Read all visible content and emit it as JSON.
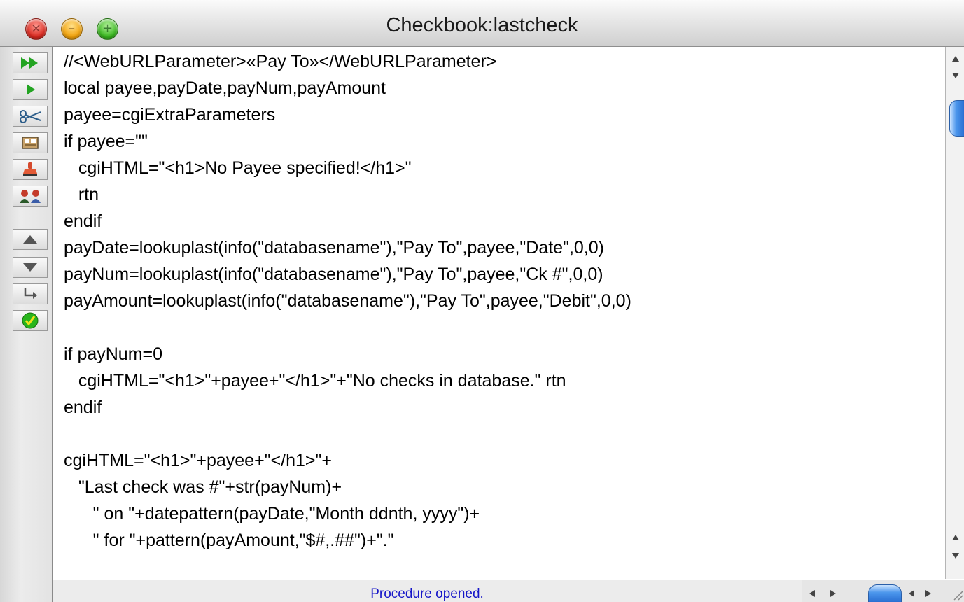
{
  "window": {
    "title": "Checkbook:lastcheck"
  },
  "traffic_lights": {
    "close_glyph": "×",
    "minimize_glyph": "–",
    "zoom_glyph": "+"
  },
  "toolbar": {
    "buttons": [
      {
        "name": "run-all",
        "icon": "double-play-icon"
      },
      {
        "name": "run-step",
        "icon": "play-icon"
      },
      {
        "name": "cut",
        "icon": "scissors-icon"
      },
      {
        "name": "dialog",
        "icon": "dialog-icon"
      },
      {
        "name": "stamp",
        "icon": "stamp-icon"
      },
      {
        "name": "people",
        "icon": "people-icon"
      },
      {
        "name": "up",
        "icon": "triangle-up-icon"
      },
      {
        "name": "down",
        "icon": "triangle-down-icon"
      },
      {
        "name": "indent",
        "icon": "return-arrow-icon"
      },
      {
        "name": "check",
        "icon": "checkmark-icon"
      }
    ],
    "accent_green": "#23a422",
    "check_green": "#28b51c"
  },
  "code_lines": [
    "//<WebURLParameter>«Pay To»</WebURLParameter>",
    "local payee,payDate,payNum,payAmount",
    "payee=cgiExtraParameters",
    "if payee=\"\"",
    "   cgiHTML=\"<h1>No Payee specified!</h1>\"",
    "   rtn",
    "endif",
    "payDate=lookuplast(info(\"databasename\"),\"Pay To\",payee,\"Date\",0,0)",
    "payNum=lookuplast(info(\"databasename\"),\"Pay To\",payee,\"Ck #\",0,0)",
    "payAmount=lookuplast(info(\"databasename\"),\"Pay To\",payee,\"Debit\",0,0)",
    "",
    "if payNum=0",
    "   cgiHTML=\"<h1>\"+payee+\"</h1>\"+\"No checks in database.\" rtn",
    "endif",
    "",
    "cgiHTML=\"<h1>\"+payee+\"</h1>\"+",
    "   \"Last check was #\"+str(payNum)+",
    "      \" on \"+datepattern(payDate,\"Month ddnth, yyyy\")+",
    "      \" for \"+pattern(payAmount,\"$#,.##\")+\".\""
  ],
  "status": {
    "text": "Procedure opened.",
    "color": "#1515c8"
  },
  "scrollbar": {
    "thumb_color": "#4b96ec"
  }
}
